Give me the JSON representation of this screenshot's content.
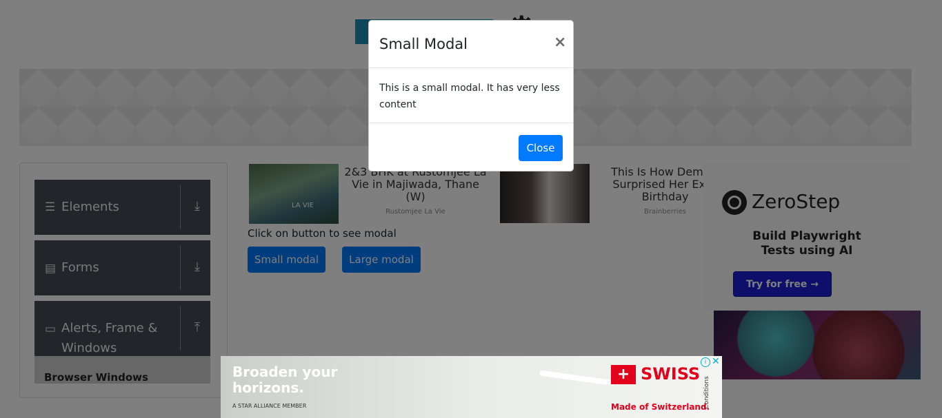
{
  "header": {
    "logo_text": ""
  },
  "sidebar": {
    "groups": [
      {
        "label": "Elements",
        "icon": "hamburger-icon",
        "arrow": "download-arrow-icon"
      },
      {
        "label": "Forms",
        "icon": "document-icon",
        "arrow": "download-arrow-icon"
      },
      {
        "label": "Alerts, Frame & Windows",
        "icon": "window-icon",
        "arrow": "upload-arrow-icon"
      }
    ],
    "active_item": "Browser Windows"
  },
  "ads": {
    "item1": {
      "title": "2&3 BHK at Rustomjee La Vie in Majiwada, Thane (W)",
      "source": "Rustomjee La Vie",
      "image_text": "LA VIE"
    },
    "item2": {
      "title": "This Is How Demi M Surprised Her Ex O Birthday",
      "source": "Brainberries"
    }
  },
  "main": {
    "instruction": "Click on button to see modal",
    "small_modal_button": "Small modal",
    "large_modal_button": "Large modal"
  },
  "right_ad": {
    "brand": "ZeroStep",
    "tagline_line1": "Build Playwright",
    "tagline_line2": "Tests using AI",
    "cta": "Try for free →"
  },
  "modal": {
    "title": "Small Modal",
    "close_symbol": "×",
    "body": "This is a small modal. It has very less content",
    "close_button": "Close"
  },
  "bottom_ad": {
    "headline_line1": "Broaden your",
    "headline_line2": "horizons.",
    "subtext": "A STAR ALLIANCE MEMBER",
    "brand": "SWISS",
    "tagline": "Made of Switzerland.",
    "conditions": "Conditions",
    "close_symbol": "✕",
    "info_symbol": "i"
  },
  "colors": {
    "primary": "#007bff",
    "sidebar_bg": "#444a54",
    "swiss_red": "#e2001a",
    "zerostep_button": "#1a1fd6"
  }
}
